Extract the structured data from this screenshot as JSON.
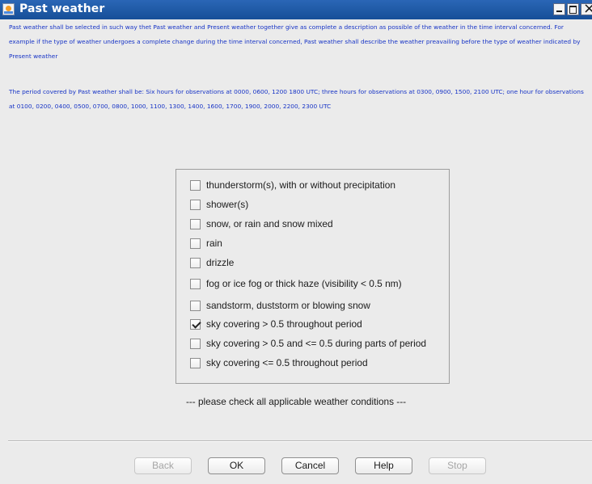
{
  "window": {
    "title": "Past weather"
  },
  "description": {
    "paragraph1": "Past weather shall be selected in such way thet Past weather and Present weather together give as complete a description as possible  of the weather in the time interval concerned. For example if the type of weather undergoes a complete change during the time interval concerned, Past weather shall describe the weather preavailing before the type of weather indicated by Present weather",
    "paragraph2": "The period covered by Past weather shall be: Six hours for observations at 0000, 0600, 1200 1800 UTC; three hours for observations at 0300, 0900, 1500, 2100 UTC; one hour for observations at 0100, 0200, 0400, 0500, 0700, 0800, 1000, 1100, 1300, 1400, 1600, 1700, 1900, 2000, 2200, 2300 UTC"
  },
  "options": [
    {
      "label": "thunderstorm(s), with or without precipitation",
      "checked": false
    },
    {
      "label": "shower(s)",
      "checked": false
    },
    {
      "label": "snow, or rain and snow mixed",
      "checked": false
    },
    {
      "label": "rain",
      "checked": false
    },
    {
      "label": "drizzle",
      "checked": false
    },
    {
      "label": "fog or ice fog or thick haze (visibility < 0.5 nm)",
      "checked": false
    },
    {
      "label": "sandstorm, duststorm or blowing snow",
      "checked": false
    },
    {
      "label": "sky covering > 0.5 throughout period",
      "checked": true
    },
    {
      "label": "sky covering > 0.5 and <= 0.5 during parts of period",
      "checked": false
    },
    {
      "label": "sky covering <= 0.5 throughout period",
      "checked": false
    }
  ],
  "hint": "--- please check all applicable weather conditions ---",
  "buttons": {
    "back": "Back",
    "ok": "OK",
    "cancel": "Cancel",
    "help": "Help",
    "stop": "Stop"
  }
}
